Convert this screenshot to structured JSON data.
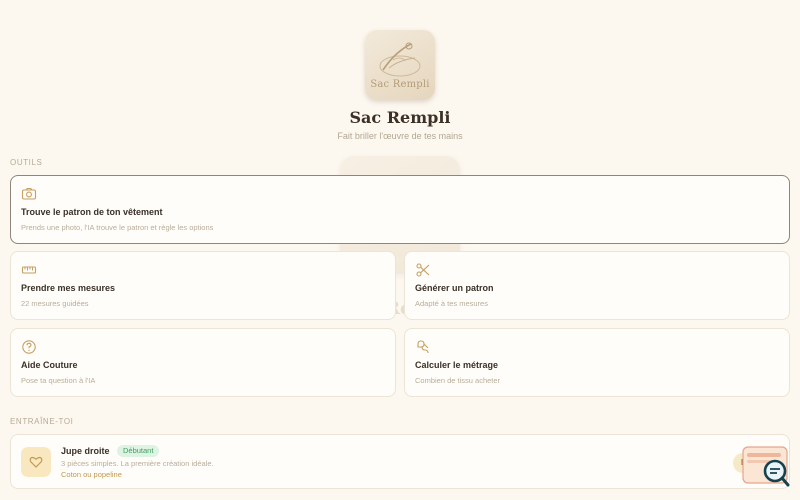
{
  "app": {
    "name": "Sac Rempli",
    "tagline": "Fait briller l'œuvre de tes mains",
    "logo_text": "Sac Rempli"
  },
  "sections": {
    "tools_label": "OUTILS",
    "training_label": "ENTRAÎNE-TOI"
  },
  "tools": {
    "featured": {
      "icon": "camera-icon",
      "title": "Trouve le patron de ton vêtement",
      "description": "Prends une photo, l'IA trouve le patron et règle les options"
    },
    "measurements": {
      "icon": "ruler-icon",
      "title": "Prendre mes mesures",
      "description": "22 mesures guidées"
    },
    "generate": {
      "icon": "scissors-icon",
      "title": "Générer un patron",
      "description": "Adapté à tes mesures"
    },
    "help": {
      "icon": "help-circle-icon",
      "title": "Aide Couture",
      "description": "Pose ta question à l'IA"
    },
    "yardage": {
      "icon": "fabric-roll-icon",
      "title": "Calculer le métrage",
      "description": "Combien de tissu acheter"
    }
  },
  "training": {
    "courses": [
      {
        "icon": "heart-icon",
        "title": "Jupe droite",
        "level": "Débutant",
        "description": "3 pièces simples. La première création idéale.",
        "fabric": "Coton ou popeline",
        "cta": "Faire"
      }
    ]
  },
  "colors": {
    "background": "#fcf7ef",
    "accent": "#c09a52",
    "badge_bg": "#dff3e4",
    "badge_text": "#3f9e5f"
  }
}
